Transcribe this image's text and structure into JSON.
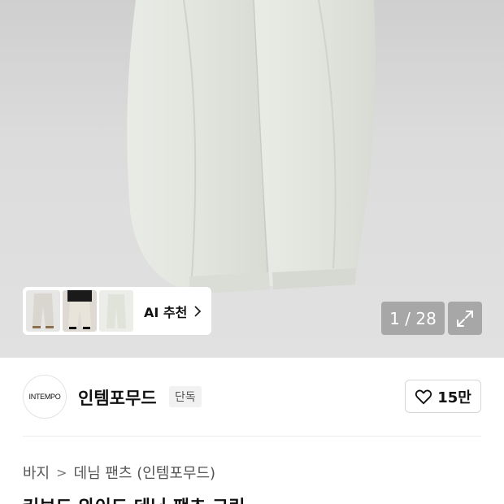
{
  "hero": {
    "counter": "1 / 28",
    "recommendation": {
      "label": "AI 추천",
      "thumbnails": [
        "thumbnail-1",
        "thumbnail-2",
        "thumbnail-3"
      ]
    }
  },
  "brand": {
    "logo_text": "INTEMPO",
    "name": "인템포무드",
    "badge": "단독",
    "like_count": "15만"
  },
  "breadcrumb": {
    "items": [
      "바지",
      "데님 팬츠 (인템포무드)"
    ]
  },
  "product": {
    "title": "커브드 와이드 데님 팬츠 그린"
  },
  "colors": {
    "hero_background": "#d8d8d8",
    "pants": "#e4e6e0",
    "overlay_button": "#8a8a8a"
  }
}
